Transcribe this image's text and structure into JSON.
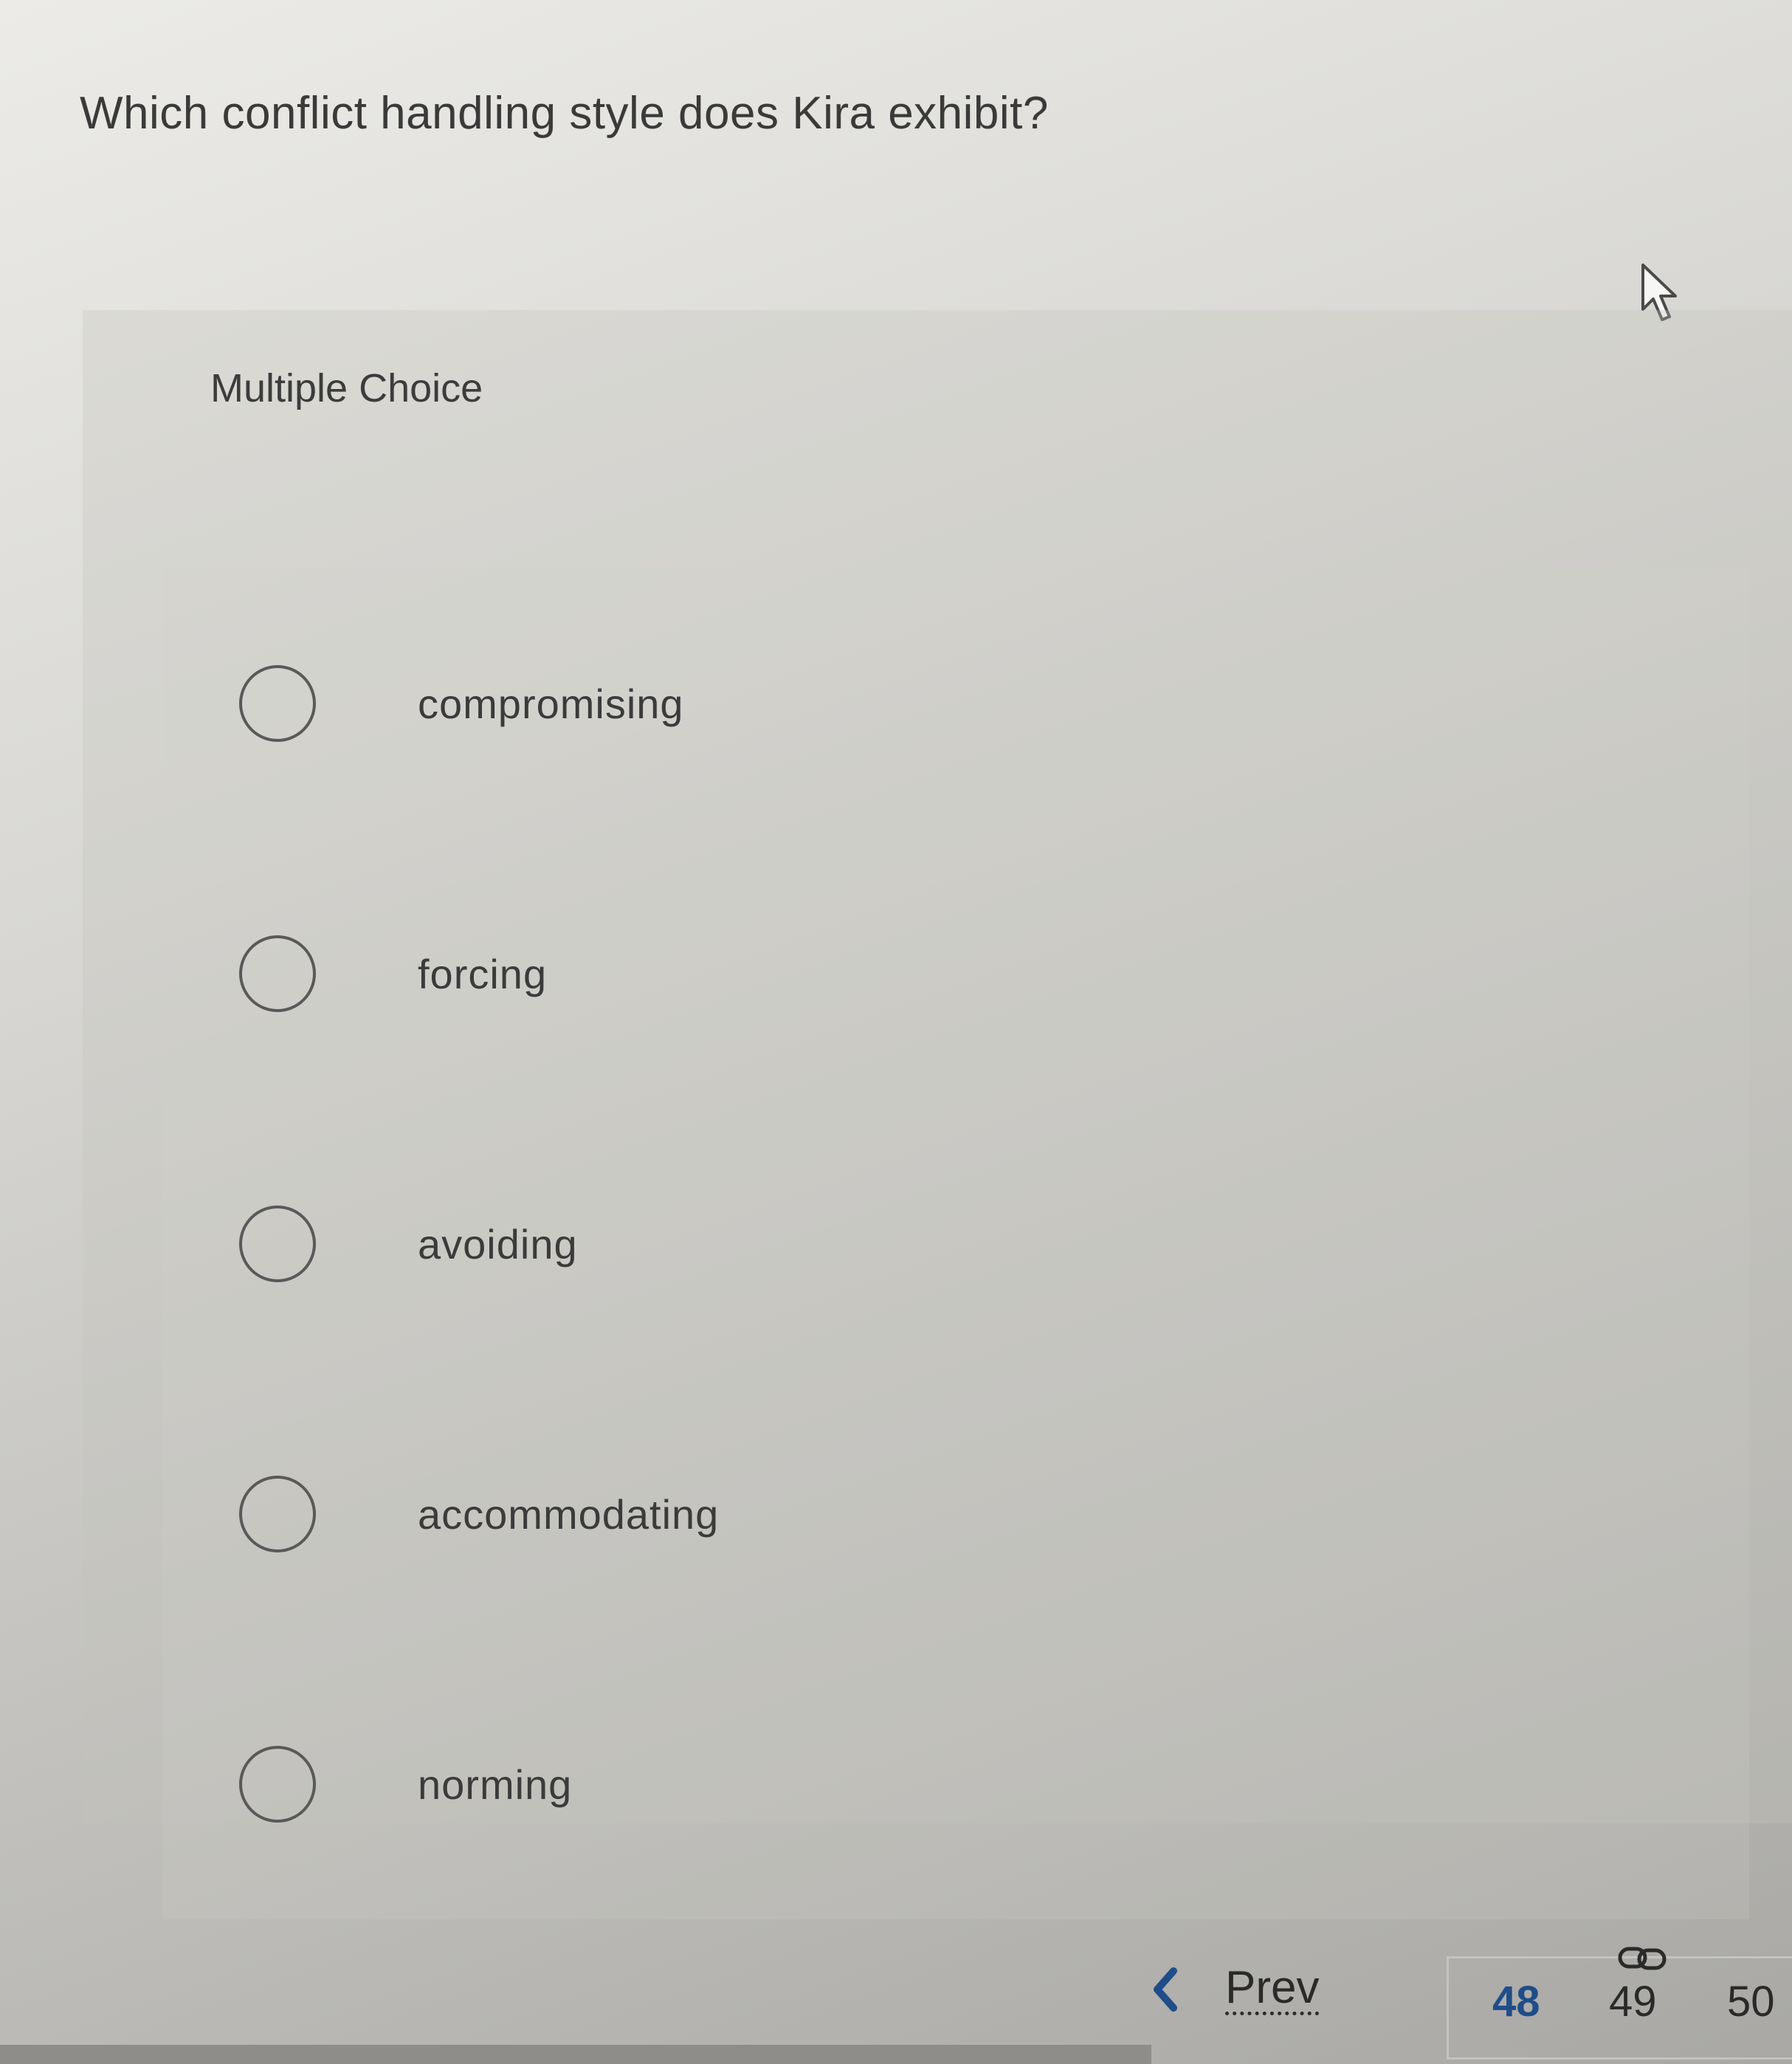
{
  "question": {
    "text": "Which conflict handling style does Kira exhibit?"
  },
  "question_type": "Multiple Choice",
  "choices": [
    {
      "label": "compromising",
      "selected": false
    },
    {
      "label": "forcing",
      "selected": false
    },
    {
      "label": "avoiding",
      "selected": false
    },
    {
      "label": "accommodating",
      "selected": false
    },
    {
      "label": "norming",
      "selected": false
    }
  ],
  "navigation": {
    "prev_label": "Prev",
    "pages": [
      "48",
      "49",
      "50"
    ],
    "current_page": "48",
    "linked_page": "49"
  },
  "colors": {
    "current_page": "#1f4d8a",
    "text": "#3a3a3a",
    "radio_border": "#595959"
  },
  "icons": {
    "cursor": "mouse-pointer-icon",
    "prev": "chevron-left-icon",
    "link": "link-icon",
    "radio": "radio-unselected-icon"
  }
}
